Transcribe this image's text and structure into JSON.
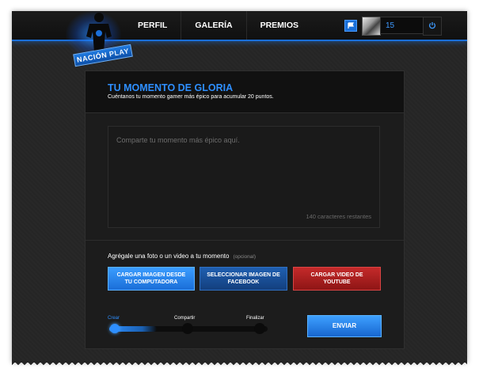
{
  "header": {
    "logo_text": "NACIÓN",
    "logo_play": "PLAY",
    "nav": [
      {
        "label": "PERFIL"
      },
      {
        "label": "GALERÍA"
      },
      {
        "label": "PREMIOS"
      }
    ],
    "points": "15",
    "power_icon": "power-icon",
    "flag_icon": "flag-icon"
  },
  "panel": {
    "title": "TU MOMENTO DE GLORIA",
    "subtitle": "Cuéntanos tu momento gamer más épico para acumular 20 puntos.",
    "textarea_placeholder": "Comparte tu momento más épico aquí.",
    "counter": "140 caracteres restantes",
    "media_label": "Agrégale una foto o un video a tu momento",
    "media_optional": "(opcional)",
    "buttons": {
      "upload_pc": "CARGAR IMAGEN DESDE TU COMPUTADORA",
      "facebook": "SELECCIONAR IMAGEN DE FACEBOOK",
      "youtube": "CARGAR VIDEO DE YOUTUBE"
    },
    "steps": [
      "Crear",
      "Compartir",
      "Finalizar"
    ],
    "progress": 0.3,
    "send": "ENVIAR"
  },
  "colors": {
    "accent": "#2e8fff",
    "youtube": "#c42a2a",
    "facebook": "#1f5fb0"
  }
}
